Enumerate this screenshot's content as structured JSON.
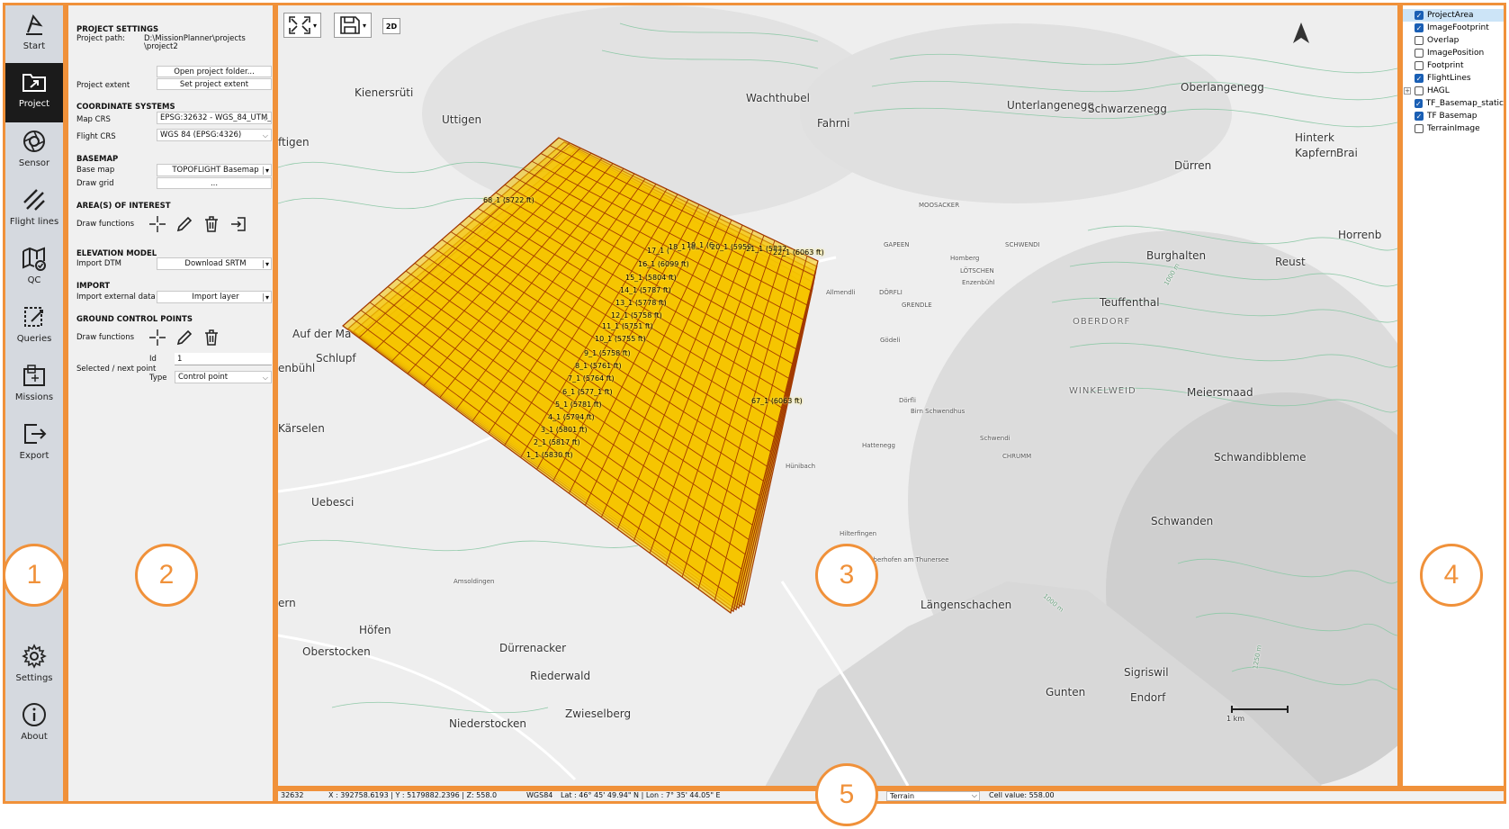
{
  "sidebar": {
    "items": [
      {
        "label": "Start",
        "icon": "start-icon"
      },
      {
        "label": "Project",
        "icon": "project-icon",
        "active": true
      },
      {
        "label": "Sensor",
        "icon": "aperture-icon"
      },
      {
        "label": "Flight lines",
        "icon": "flight-lines-icon"
      },
      {
        "label": "QC",
        "icon": "qc-map-check-icon"
      },
      {
        "label": "Queries",
        "icon": "queries-icon"
      },
      {
        "label": "Missions",
        "icon": "missions-icon"
      },
      {
        "label": "Export",
        "icon": "export-icon"
      },
      {
        "label": "Settings",
        "icon": "gear-icon"
      },
      {
        "label": "About",
        "icon": "info-icon"
      }
    ]
  },
  "panel": {
    "project_settings": "PROJECT SETTINGS",
    "project_path_label": "Project path:",
    "project_path_line1": "D:\\MissionPlanner\\projects",
    "project_path_line2": "\\project2",
    "open_project_folder": "Open project folder...",
    "project_extent_label": "Project extent",
    "set_project_extent": "Set project extent",
    "coordinate_systems": "COORDINATE SYSTEMS",
    "map_crs_label": "Map CRS",
    "map_crs_value": "EPSG:32632 - WGS_84_UTM_",
    "flight_crs_label": "Flight CRS",
    "flight_crs_value": "WGS 84 (EPSG:4326)",
    "basemap": "BASEMAP",
    "base_map_label": "Base map",
    "base_map_value": "TOPOFLIGHT Basemap",
    "draw_grid_label": "Draw grid",
    "draw_grid_value": "...",
    "aoi": "AREA(S) OF INTEREST",
    "draw_functions_label": "Draw functions",
    "elevation_model": "ELEVATION MODEL",
    "import_dtm_label": "Import DTM",
    "download_srtm": "Download SRTM",
    "import": "IMPORT",
    "import_external_label": "Import external data",
    "import_layer": "Import layer",
    "gcp": "GROUND CONTROL POINTS",
    "gcp_draw_functions_label": "Draw functions",
    "selected_next_point_label": "Selected / next point",
    "id_label": "Id",
    "id_value": "1",
    "type_label": "Type",
    "type_value": "Control point"
  },
  "map": {
    "toolbar": {
      "mode_2d": "2D"
    },
    "places": [
      "Kienersrüti",
      "Wachthubel",
      "Unterlangenegg",
      "Oberlangenegg",
      "Fahrni",
      "Schwarzenegg",
      "Uttigen",
      "ftigen",
      "Hinterk",
      "Kapfern",
      "Brai",
      "Dürren",
      "Horrenb",
      "Burghalten",
      "Reust",
      "Teuffenthal",
      "OBERDORF",
      "Auf der Ma",
      "Schlupf",
      "enbühl",
      "WINKELWEID",
      "Meiersmaad",
      "Kärselen",
      "Uebesci",
      "Schwandibbleme",
      "Schwanden",
      "ern",
      "Höfen",
      "Oberstocken",
      "Dürrenacker",
      "Riederwald",
      "Längenschachen",
      "Sigriswil",
      "Gunten",
      "Endorf",
      "Niederstocken",
      "Zwieselberg"
    ],
    "small_places": [
      "MOOSACKER",
      "GAPEEN",
      "SCHWENDI",
      "Homberg",
      "LÖTSCHEN",
      "Enzenbühl",
      "Allmendli",
      "DÖRFLI",
      "GRENDLE",
      "Gödeli",
      "Dörfli",
      "Birn Schwendhus",
      "Schwendi",
      "Hattenegg",
      "Hünibach",
      "CHRUMM",
      "Hilterfingen",
      "Oberhofen am Thunersee",
      "Amsoldingen"
    ],
    "contour_labels": [
      "1000 m",
      "1000 m",
      "1250 m"
    ],
    "flight_line_labels": [
      "68_1 (5722 ft)",
      "17_1 (",
      "18_1 (6",
      "19_1 (6",
      "20_1 (5950",
      "21_1 (5832",
      "22_1 (6063 ft)",
      "16_1 (6099 ft)",
      "15_1 (5804 ft)",
      "14_1 (5787 ft)",
      "13_1 (5778 ft)",
      "12_1 (5758 ft)",
      "11_1 (5751 ft)",
      "10_1 (5755 ft)",
      "9_1 (5758 ft)",
      "8_1 (5761 ft)",
      "7_1 (5764 ft)",
      "6_1 (577_1 ft)",
      "5_1 (5781 ft)",
      "4_1 (5794 ft)",
      "3_1 (5801 ft)",
      "2_1 (5817 ft)",
      "1_1 (5830 ft)",
      "67_1 (6063 ft)"
    ],
    "scale_label": "1 km",
    "footprint_color": "#f5c400",
    "footprint_stroke": "#a33a00"
  },
  "layers": {
    "items": [
      {
        "label": "ProjectArea",
        "checked": true,
        "selected": true
      },
      {
        "label": "ImageFootprint",
        "checked": true
      },
      {
        "label": "Overlap",
        "checked": false
      },
      {
        "label": "ImagePosition",
        "checked": false
      },
      {
        "label": "Footprint",
        "checked": false
      },
      {
        "label": "FlightLines",
        "checked": true
      },
      {
        "label": "HAGL",
        "checked": false,
        "expandable": true
      },
      {
        "label": "TF_Basemap_static",
        "checked": true
      },
      {
        "label": "TF Basemap",
        "checked": true
      },
      {
        "label": "TerrainImage",
        "checked": false
      }
    ]
  },
  "status": {
    "epsg": "32632",
    "xyz": "X : 392758.6193 | Y : 5179882.2396 | Z: 558.0",
    "crs": "WGS84",
    "latlon": "Lat : 46° 45' 49.94\" N | Lon : 7° 35' 44.05\" E",
    "layer_select": "Terrain",
    "cell_value": "Cell value: 558.00"
  },
  "callouts": [
    "1",
    "2",
    "3",
    "4",
    "5"
  ],
  "accent_color": "#f0913a"
}
